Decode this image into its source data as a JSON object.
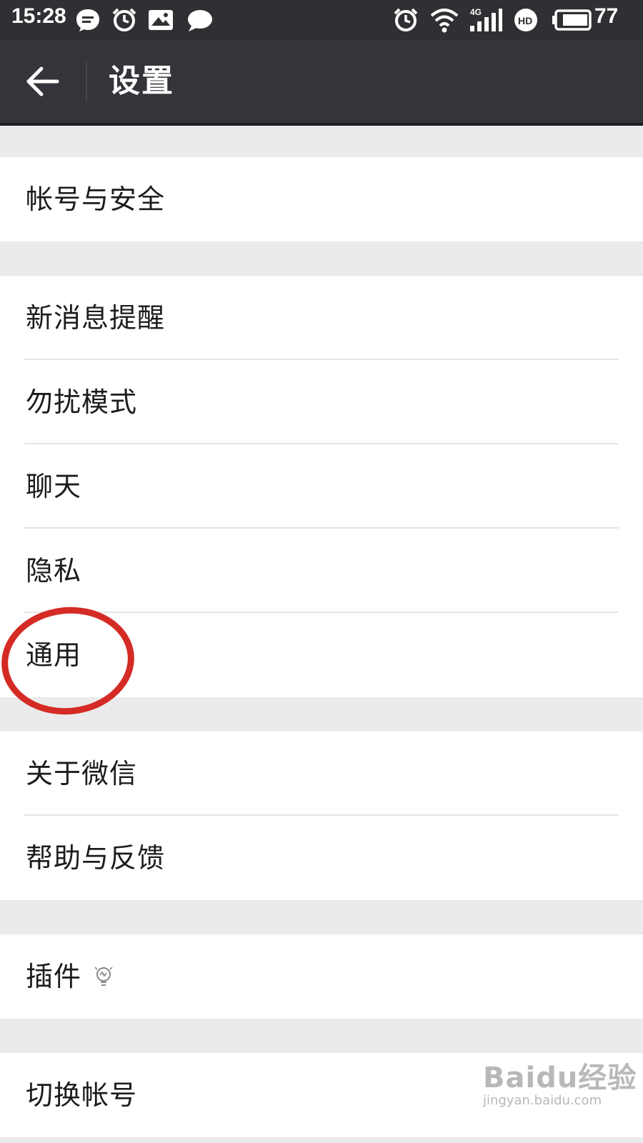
{
  "status_bar": {
    "time": "15:28",
    "battery_percent": "77",
    "network": "4G",
    "notification_icons": [
      "message-icon",
      "alarm-icon",
      "mail-icon",
      "chat-bubble-icon"
    ],
    "system_icons": [
      "alarm-icon",
      "wifi-icon",
      "signal-icon",
      "hd-icon",
      "battery-icon"
    ]
  },
  "app_bar": {
    "title": "设置",
    "back_icon": "back-arrow-icon",
    "background": "#34353a"
  },
  "groups": [
    {
      "items": [
        {
          "label": "帐号与安全"
        }
      ]
    },
    {
      "items": [
        {
          "label": "新消息提醒"
        },
        {
          "label": "勿扰模式"
        },
        {
          "label": "聊天"
        },
        {
          "label": "隐私"
        },
        {
          "label": "通用"
        }
      ]
    },
    {
      "items": [
        {
          "label": "关于微信"
        },
        {
          "label": "帮助与反馈"
        }
      ]
    },
    {
      "items": [
        {
          "label": "插件",
          "icon": "lightbulb-icon"
        }
      ]
    },
    {
      "items": [
        {
          "label": "切换帐号"
        }
      ]
    }
  ],
  "annotation": {
    "target": "通用",
    "color": "#d42b25"
  },
  "watermark": {
    "brand": "Baidu经验",
    "url": "jingyan.baidu.com"
  }
}
